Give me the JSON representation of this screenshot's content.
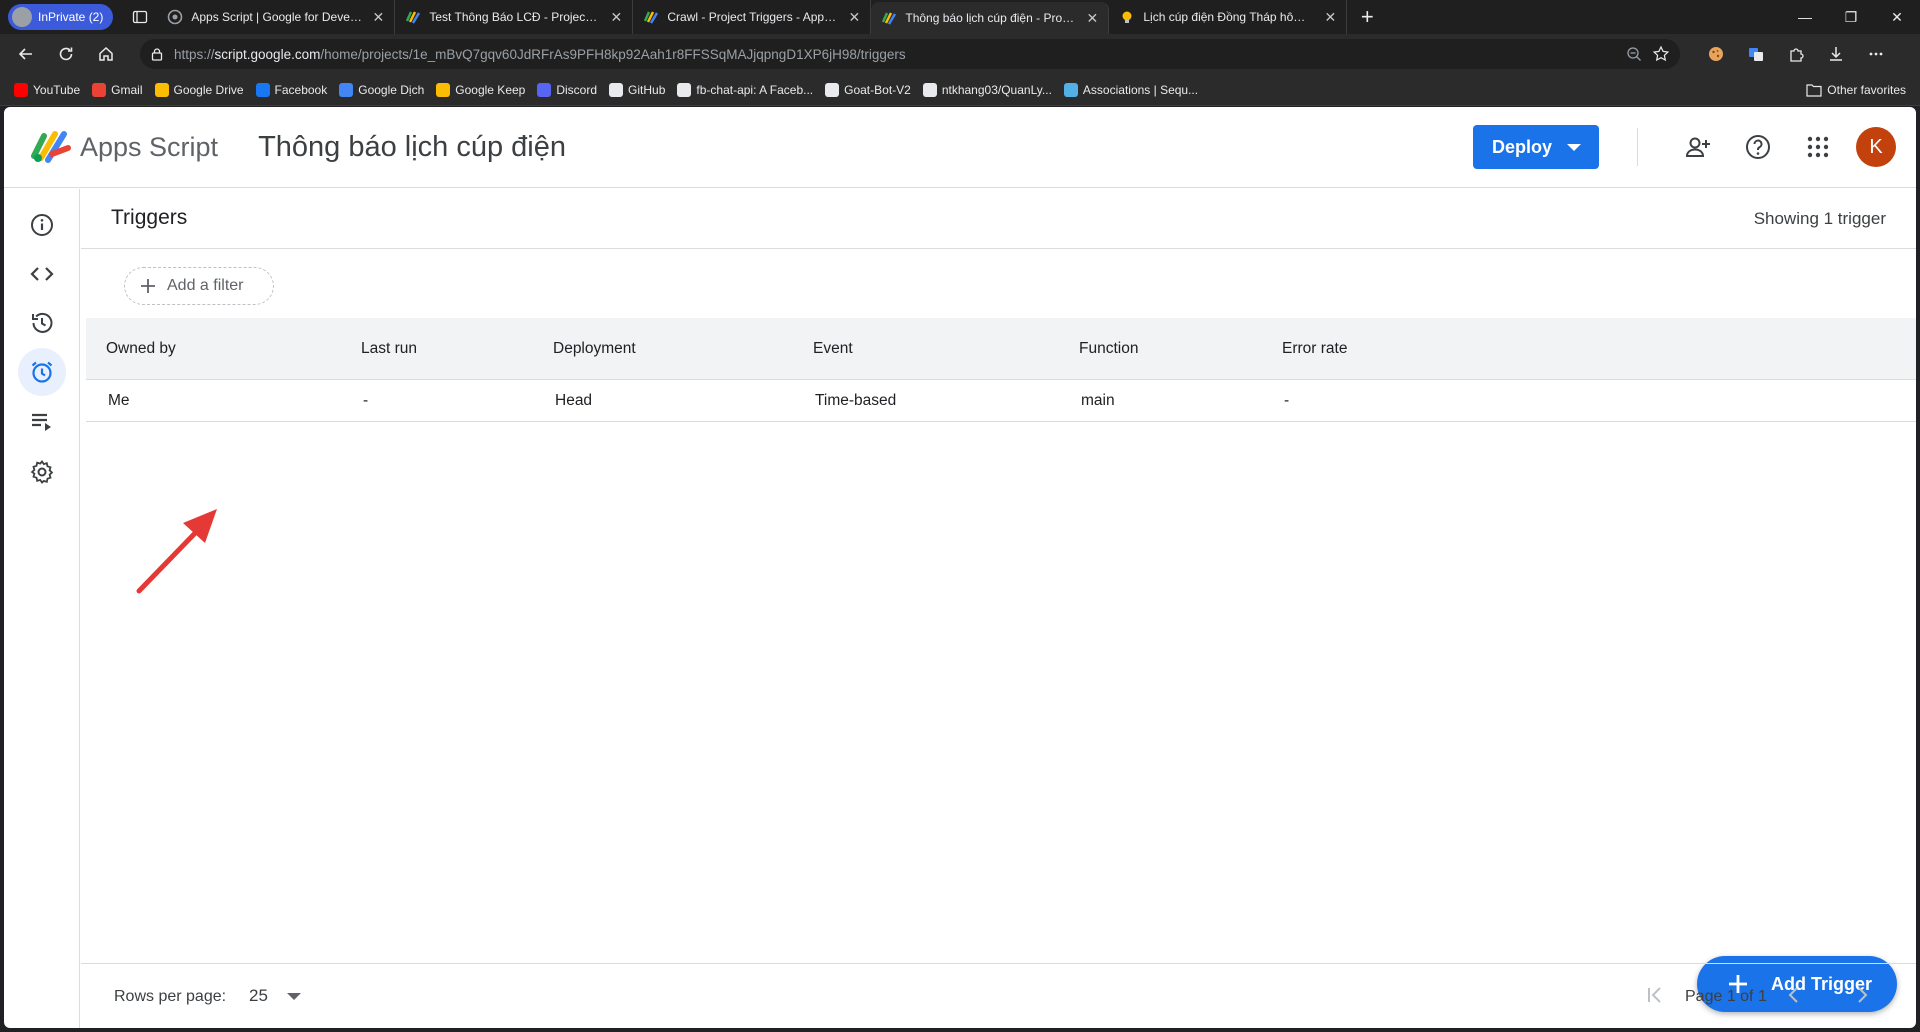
{
  "browser": {
    "inprivate_label": "InPrivate (2)",
    "tabs": [
      {
        "title": "Apps Script  |  Google for Develop",
        "favicon": "google-developers-icon"
      },
      {
        "title": "Test Thông Báo LCĐ - Project Edit",
        "favicon": "apps-script-icon"
      },
      {
        "title": "Crawl - Project Triggers - Apps Sc",
        "favicon": "apps-script-icon"
      },
      {
        "title": "Thông báo lịch cúp điện - Project",
        "favicon": "apps-script-icon",
        "active": true
      },
      {
        "title": "Lịch cúp điện Đồng Tháp hôm na",
        "favicon": "lightbulb-icon"
      }
    ],
    "url_prefix": "https://",
    "url_host": "script.google.com",
    "url_path": "/home/projects/1e_mBvQ7gqv60JdRFrAs9PFH8kp92Aah1r8FFSSqMAJjqpngD1XP6jH98/triggers",
    "bookmarks": [
      {
        "label": "YouTube",
        "color": "#ff0000"
      },
      {
        "label": "Gmail",
        "color": "#ea4335"
      },
      {
        "label": "Google Drive",
        "color": "#fbbc04"
      },
      {
        "label": "Facebook",
        "color": "#1877f2"
      },
      {
        "label": "Google Dịch",
        "color": "#4285f4"
      },
      {
        "label": "Google Keep",
        "color": "#fbbc04"
      },
      {
        "label": "Discord",
        "color": "#5865f2"
      },
      {
        "label": "GitHub",
        "color": "#e8eaed"
      },
      {
        "label": "fb-chat-api: A Faceb...",
        "color": "#e8eaed"
      },
      {
        "label": "Goat-Bot-V2",
        "color": "#e8eaed"
      },
      {
        "label": "ntkhang03/QuanLy...",
        "color": "#e8eaed"
      },
      {
        "label": "Associations | Sequ...",
        "color": "#52b0e7"
      }
    ],
    "other_favorites": "Other favorites"
  },
  "header": {
    "app_name": "Apps Script",
    "project_title": "Thông báo lịch cúp điện",
    "deploy_label": "Deploy",
    "avatar_initial": "K",
    "accent": "#1a73e8"
  },
  "triggers": {
    "title": "Triggers",
    "showing": "Showing 1 trigger",
    "add_filter": "Add a filter",
    "columns": [
      "Owned by",
      "Last run",
      "Deployment",
      "Event",
      "Function",
      "Error rate"
    ],
    "rows": [
      [
        "Me",
        "-",
        "Head",
        "Time-based",
        "main",
        "-"
      ]
    ],
    "add_trigger_label": "Add Trigger"
  },
  "footer": {
    "rows_per_page_label": "Rows per page:",
    "rows_per_page_value": "25",
    "page_label": "Page 1 of 1"
  }
}
